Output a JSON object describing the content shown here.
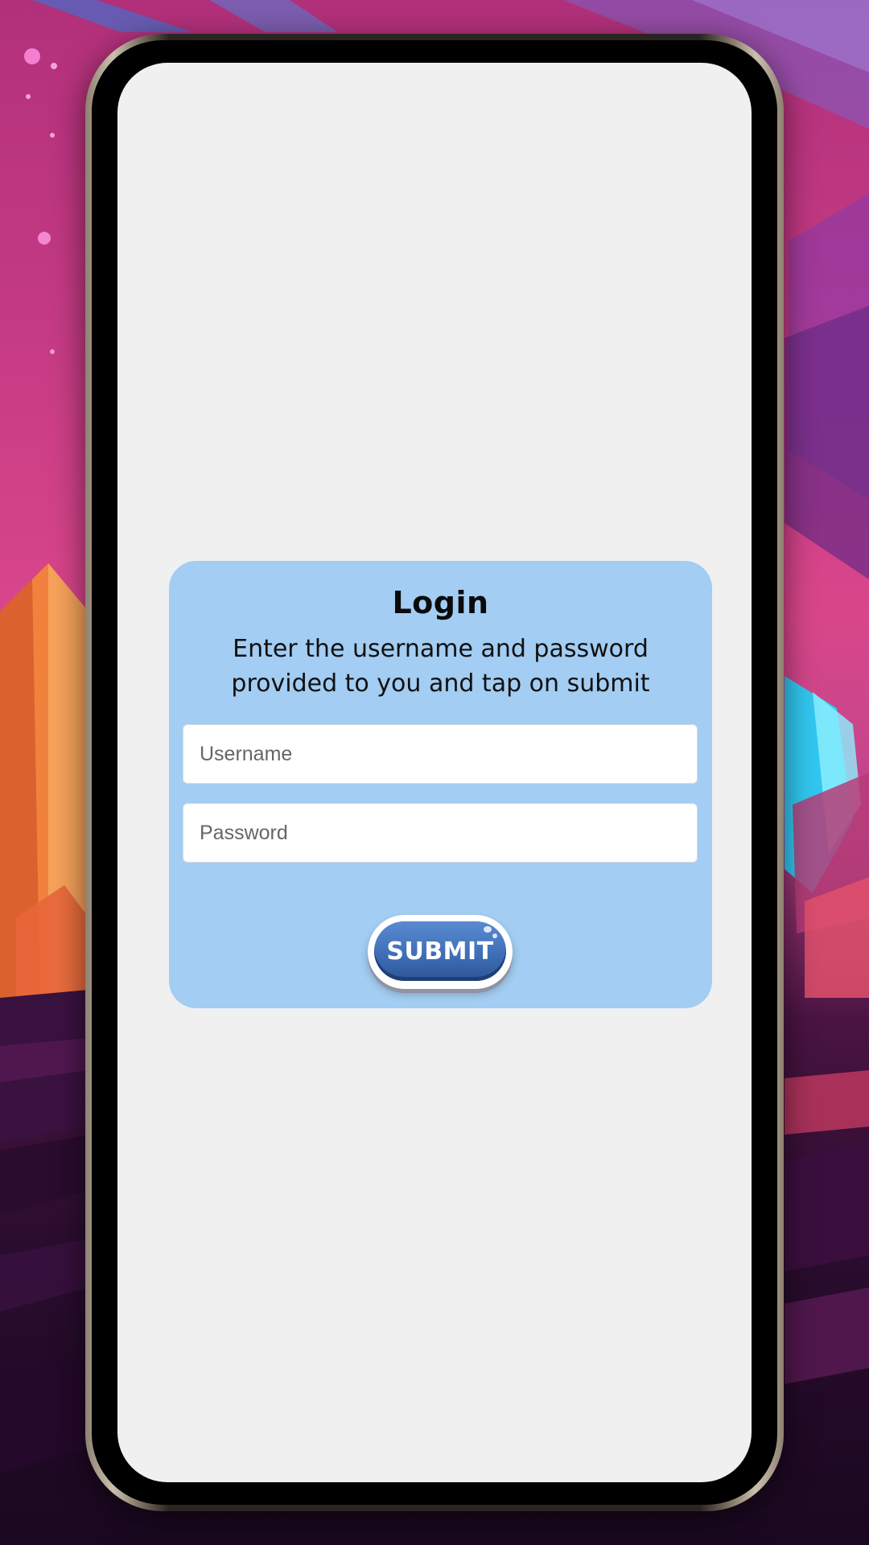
{
  "login": {
    "title": "Login",
    "subtitle_line1": "Enter the username and password",
    "subtitle_line2": "provided to you and tap on submit",
    "username_placeholder": "Username",
    "password_placeholder": "Password",
    "submit_label": "SUBMIT"
  },
  "colors": {
    "screen_background": "#f0f0f1",
    "card_background": "#a3cdf2",
    "submit_button": "#3f6fb8"
  }
}
